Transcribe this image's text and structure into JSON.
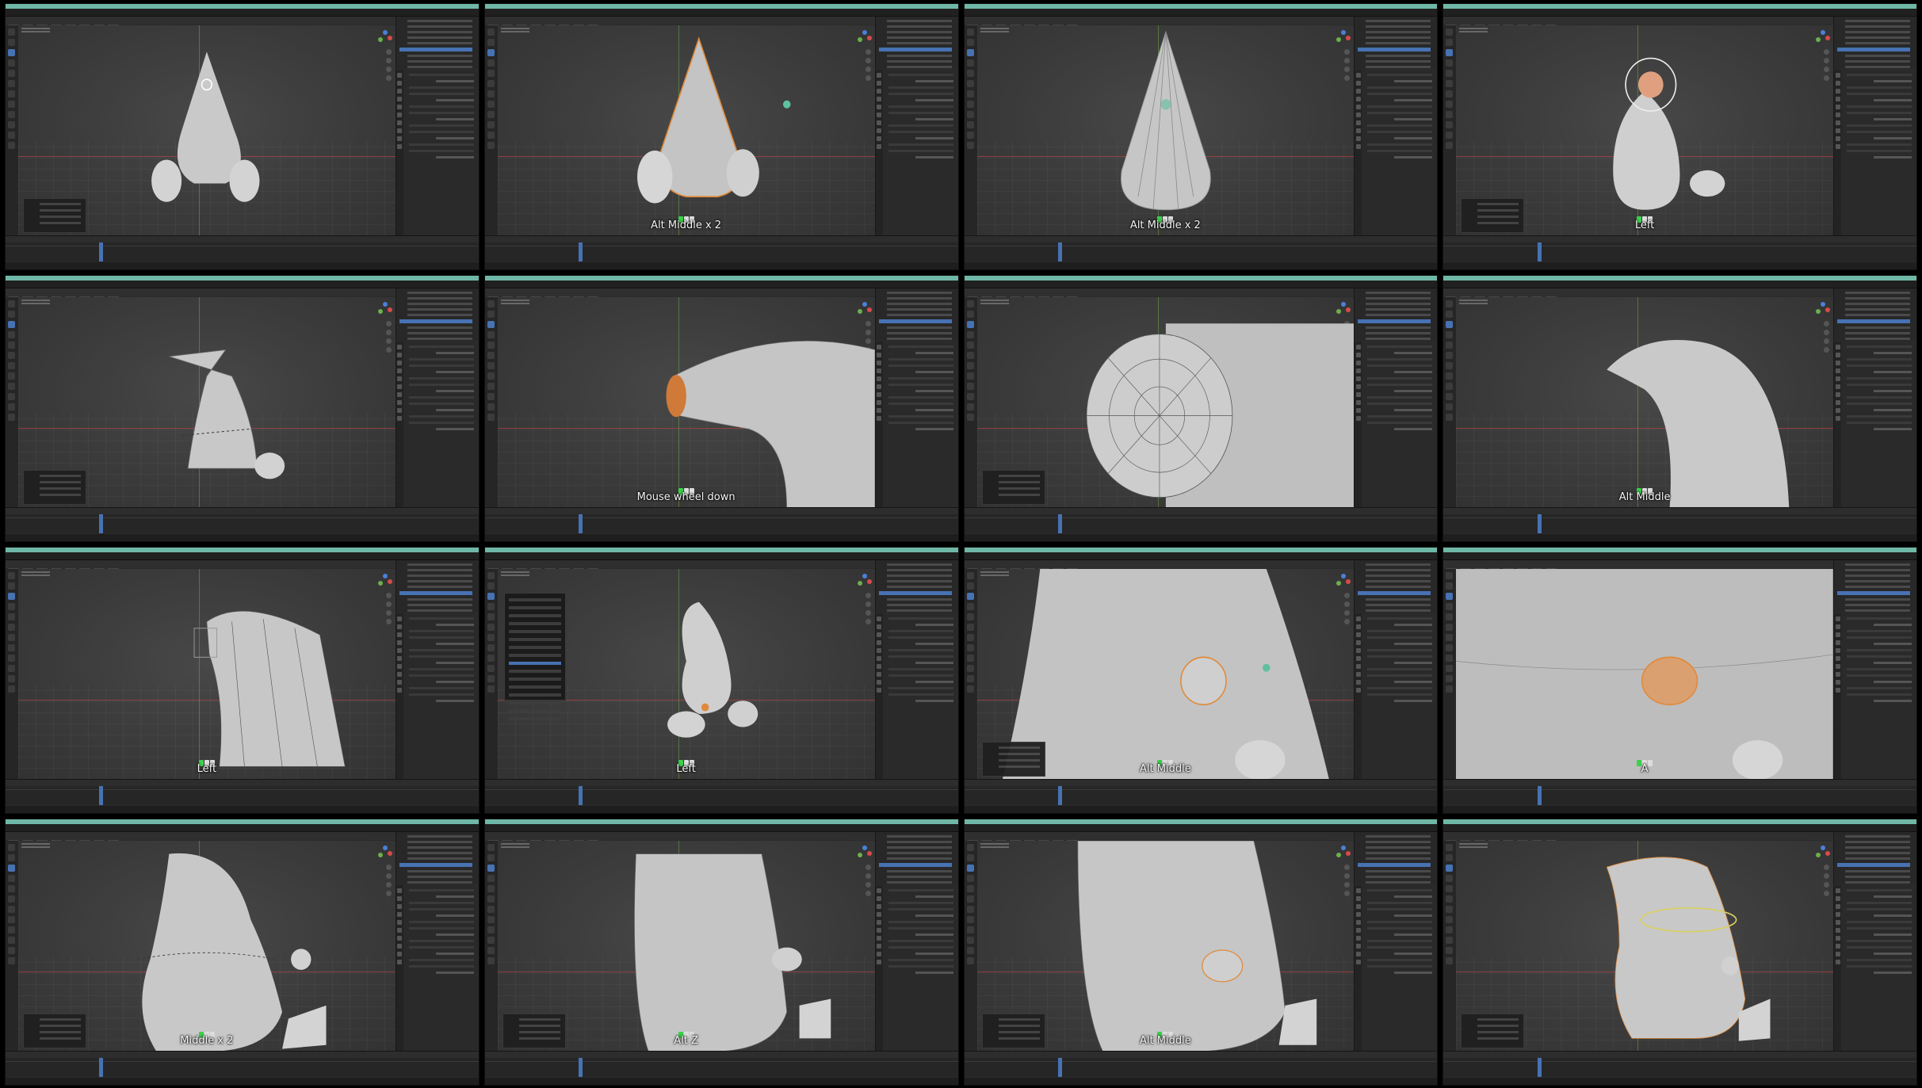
{
  "app": "Blender",
  "panels": [
    {
      "id": "p1",
      "overlay": "",
      "mode": "object"
    },
    {
      "id": "p2",
      "overlay": "Alt Middle x 2",
      "mode": "edit"
    },
    {
      "id": "p3",
      "overlay": "Alt Middle x 2",
      "mode": "edit"
    },
    {
      "id": "p4",
      "overlay": "Left",
      "mode": "edit"
    },
    {
      "id": "p5",
      "overlay": "",
      "mode": "edit"
    },
    {
      "id": "p6",
      "overlay": "Mouse wheel down",
      "mode": "edit"
    },
    {
      "id": "p7",
      "overlay": "",
      "mode": "edit"
    },
    {
      "id": "p8",
      "overlay": "Alt Middle",
      "mode": "object"
    },
    {
      "id": "p9",
      "overlay": "Left",
      "mode": "edit"
    },
    {
      "id": "p10",
      "overlay": "Left",
      "mode": "object"
    },
    {
      "id": "p11",
      "overlay": "Alt Middle",
      "mode": "object"
    },
    {
      "id": "p12",
      "overlay": "A",
      "mode": "edit"
    },
    {
      "id": "p13",
      "overlay": "Middle x 2",
      "mode": "edit"
    },
    {
      "id": "p14",
      "overlay": "Alt Z",
      "mode": "edit"
    },
    {
      "id": "p15",
      "overlay": "Alt Middle",
      "mode": "edit"
    },
    {
      "id": "p16",
      "overlay": "",
      "mode": "edit"
    }
  ],
  "colors": {
    "titlebar": "#6fb7a7",
    "selection": "#4772b3",
    "edit_orange": "#e08a3a",
    "mesh_gray": "#cfcfcf",
    "key_green": "#3bd14a"
  }
}
